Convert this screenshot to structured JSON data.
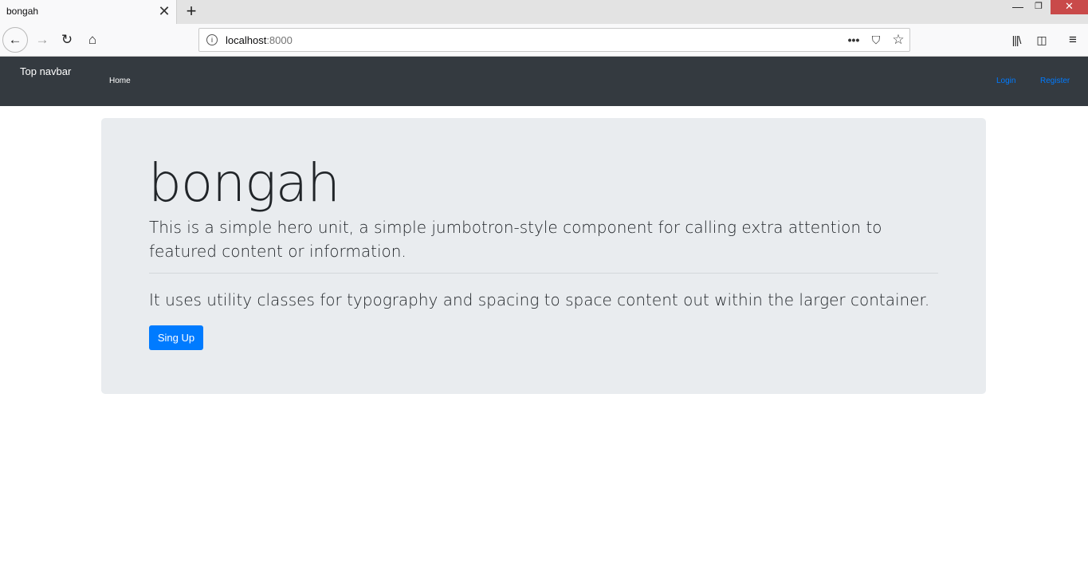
{
  "browser": {
    "tab_title": "bongah",
    "tab_close": "✕",
    "new_tab": "+",
    "window": {
      "minimize": "—",
      "maximize": "❐",
      "close": "✕"
    },
    "nav": {
      "back": "←",
      "forward": "→",
      "reload": "↻",
      "home": "⌂"
    },
    "url": {
      "host": "localhost",
      "port": ":8000",
      "info_icon": "i"
    },
    "url_icons": {
      "more": "•••",
      "pocket": "⛉",
      "bookmark": "☆"
    },
    "toolbar": {
      "library": "|||\\",
      "sidebar": "◫",
      "menu": "≡"
    }
  },
  "site_navbar": {
    "brand": "Top navbar",
    "items": [
      {
        "label": "Home"
      }
    ],
    "right_items": [
      {
        "label": "Login"
      },
      {
        "label": "Register"
      }
    ]
  },
  "jumbotron": {
    "heading": "bongah",
    "lead": "This is a simple hero unit, a simple jumbotron-style component for calling extra attention to featured content or information.",
    "text": "It uses utility classes for typography and spacing to space content out within the larger container.",
    "button_label": "Sing Up"
  },
  "colors": {
    "navbar_bg": "#343a40",
    "jumbotron_bg": "#e9ecef",
    "primary": "#007bff",
    "window_close": "#c94a4a"
  }
}
